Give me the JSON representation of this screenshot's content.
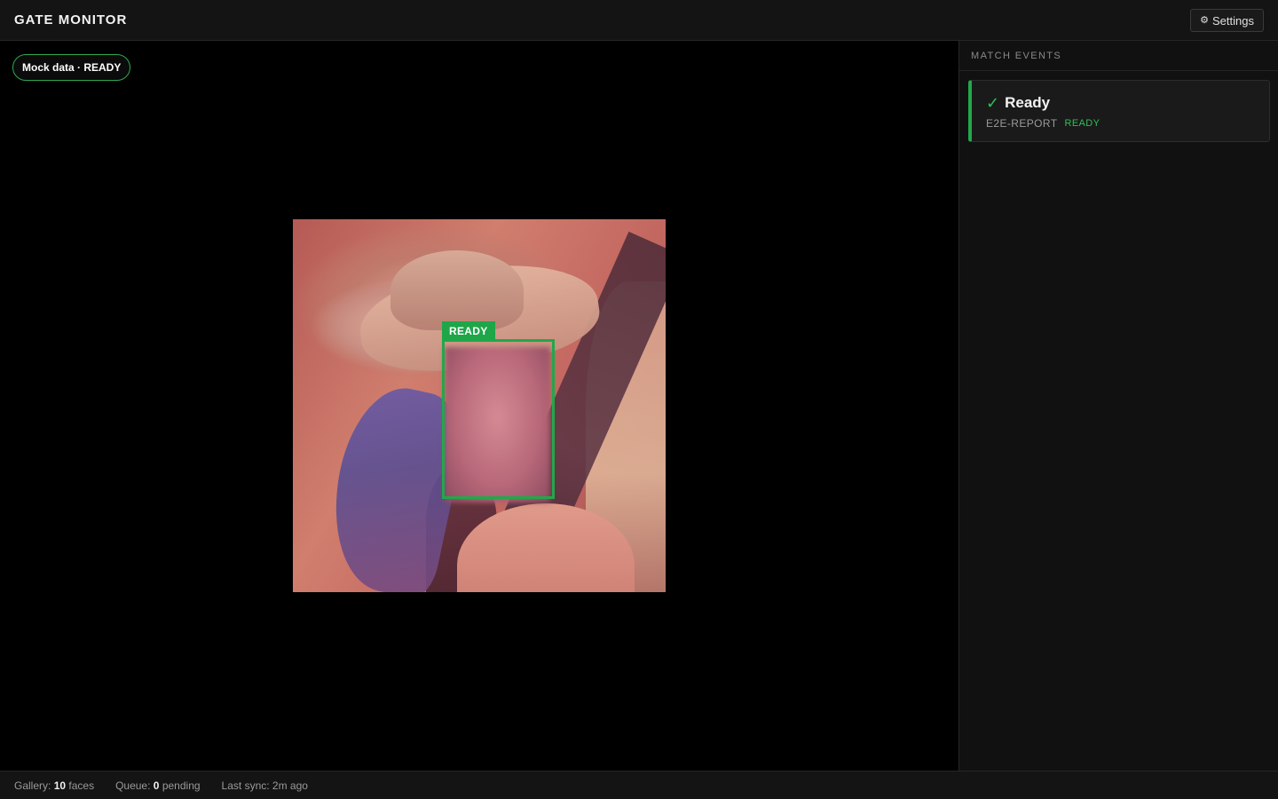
{
  "header": {
    "title": "GATE MONITOR",
    "settings_icon": "gear-icon",
    "settings_label": "Settings"
  },
  "viewer": {
    "status_pill": "Mock data · READY",
    "detection_label": "READY"
  },
  "sidebar": {
    "heading": "MATCH EVENTS",
    "events": [
      {
        "icon": "check-icon",
        "title": "Ready",
        "id": "E2E-REPORT",
        "status": "READY"
      }
    ]
  },
  "footer": {
    "gallery_label": "Gallery:",
    "gallery_count": "10",
    "gallery_unit": "faces",
    "queue_label": "Queue:",
    "queue_count": "0",
    "queue_unit": "pending",
    "last_sync": "Last sync: 2m ago"
  },
  "colors": {
    "accent_green": "#21a84a",
    "background": "#000000",
    "panel": "#111111"
  }
}
